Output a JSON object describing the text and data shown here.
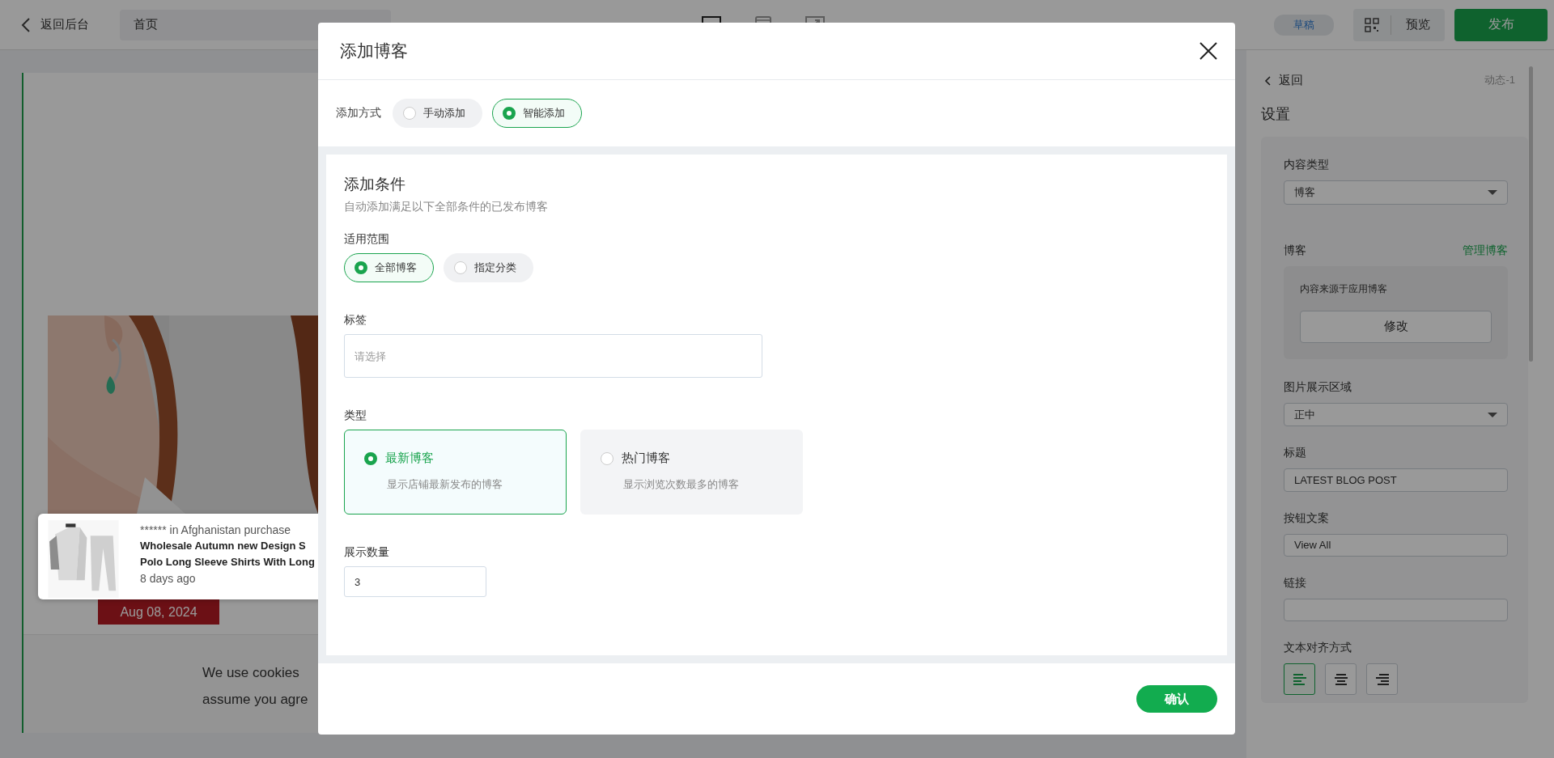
{
  "topbar": {
    "back_label": "返回后台",
    "page_field": "首页",
    "devices": [
      {
        "kind": "desktop",
        "selected": true
      },
      {
        "kind": "tablet",
        "selected": false
      },
      {
        "kind": "mobile",
        "selected": false
      }
    ],
    "status_badge": "草稿",
    "preview_label": "预览",
    "publish_label": "发布"
  },
  "preview": {
    "notification": {
      "buyer_line": "****** in Afghanistan purchase",
      "product_lines": [
        "Wholesale Autumn new Design S",
        "Polo Long Sleeve Shirts With Long"
      ],
      "time": "8 days ago"
    },
    "date_badge": "Aug 08, 2024",
    "cookie_lines": [
      "We use cookies",
      "assume you agre"
    ]
  },
  "settings": {
    "back_label": "返回",
    "section_tag": "动态-1",
    "title": "设置",
    "content_type": {
      "label": "内容类型",
      "value": "博客"
    },
    "blog": {
      "label": "博客",
      "link": "管理博客",
      "note": "内容来源于应用博客",
      "button": "修改"
    },
    "image_area": {
      "label": "图片展示区域",
      "value": "正中"
    },
    "title_field": {
      "label": "标题",
      "value": "LATEST BLOG POST"
    },
    "button_text": {
      "label": "按钮文案",
      "value": "View All"
    },
    "link": {
      "label": "链接"
    },
    "align": {
      "label": "文本对齐方式",
      "options": [
        {
          "kind": "left",
          "selected": true
        },
        {
          "kind": "center",
          "selected": false
        },
        {
          "kind": "right",
          "selected": false
        }
      ]
    }
  },
  "modal": {
    "title": "添加博客",
    "method": {
      "label": "添加方式",
      "options": [
        {
          "label": "手动添加",
          "selected": false
        },
        {
          "label": "智能添加",
          "selected": true
        }
      ]
    },
    "conditions": {
      "title": "添加条件",
      "subtitle": "自动添加满足以下全部条件的已发布博客",
      "scope": {
        "label": "适用范围",
        "options": [
          {
            "label": "全部博客",
            "selected": true
          },
          {
            "label": "指定分类",
            "selected": false
          }
        ]
      },
      "tags": {
        "label": "标签",
        "placeholder": "请选择"
      },
      "type": {
        "label": "类型",
        "options": [
          {
            "label": "最新博客",
            "description": "显示店铺最新发布的博客",
            "selected": true
          },
          {
            "label": "热门博客",
            "description": "显示浏览次数最多的博客",
            "selected": false
          }
        ]
      },
      "count": {
        "label": "展示数量",
        "value": "3"
      }
    },
    "confirm": "确认"
  }
}
